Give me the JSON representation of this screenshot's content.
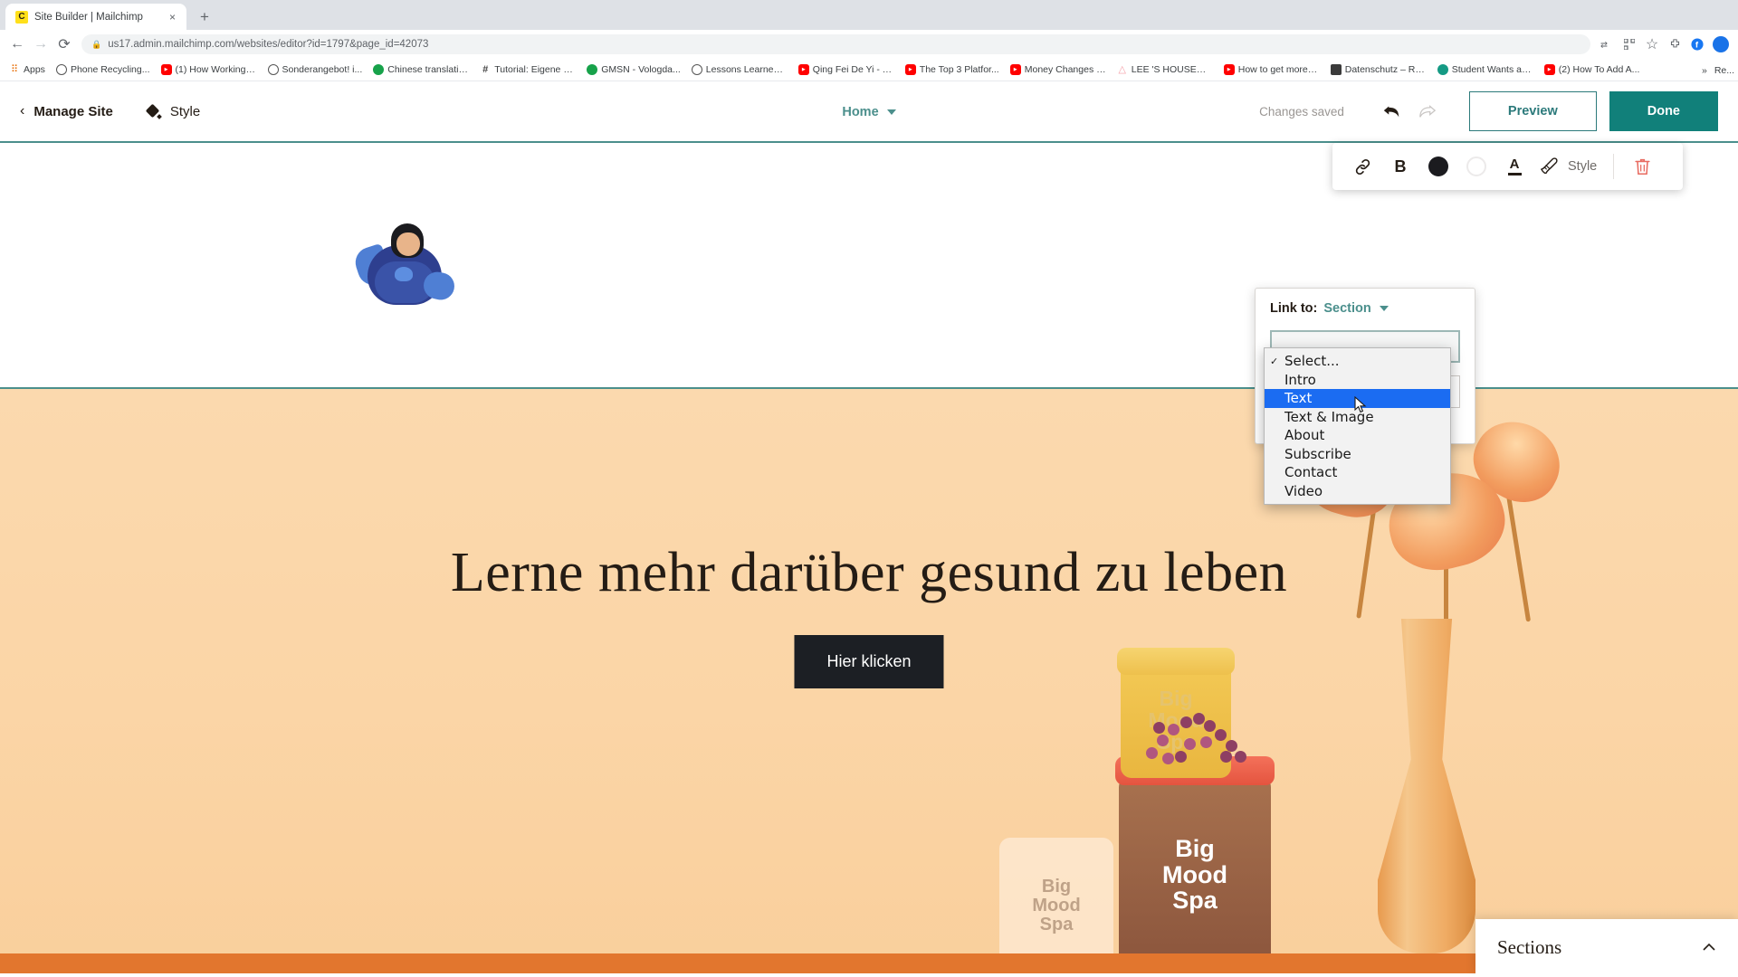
{
  "browser": {
    "tab": {
      "title": "Site Builder | Mailchimp",
      "favicon": "mailchimp-icon",
      "close_label": "×",
      "new_tab_label": "+"
    },
    "nav": {
      "back": "←",
      "forward": "→",
      "reload": "⟳",
      "lock": "🔒",
      "url": "us17.admin.mailchimp.com/websites/editor?id=1797&page_id=42073",
      "translate": "translate-icon",
      "qr": "qr-icon",
      "star": "☆",
      "extensions": "🧩",
      "facebook": "f",
      "profile": "profile-avatar"
    },
    "bookmarks": [
      {
        "label": "Apps",
        "icon": "apps-grid-icon",
        "icon_class": "ico-apps",
        "glyph": "⠿"
      },
      {
        "label": "Phone Recycling...",
        "icon": "o2-icon",
        "icon_class": "ico-circle",
        "glyph": ""
      },
      {
        "label": "(1) How Working a...",
        "icon": "youtube-icon",
        "icon_class": "ico-yt",
        "glyph": ""
      },
      {
        "label": "Sonderangebot! i...",
        "icon": "generic-icon",
        "icon_class": "ico-circle",
        "glyph": ""
      },
      {
        "label": "Chinese translatio...",
        "icon": "green-circle-icon",
        "icon_class": "ico-green",
        "glyph": ""
      },
      {
        "label": "Tutorial: Eigene Fa...",
        "icon": "hash-icon",
        "icon_class": "ico-hash",
        "glyph": "#"
      },
      {
        "label": "GMSN - Vologda...",
        "icon": "green-circle-icon",
        "icon_class": "ico-green",
        "glyph": ""
      },
      {
        "label": "Lessons Learned f...",
        "icon": "generic-icon",
        "icon_class": "ico-circle",
        "glyph": ""
      },
      {
        "label": "Qing Fei De Yi - Y...",
        "icon": "youtube-icon",
        "icon_class": "ico-yt",
        "glyph": ""
      },
      {
        "label": "The Top 3 Platfor...",
        "icon": "youtube-icon",
        "icon_class": "ico-yt",
        "glyph": ""
      },
      {
        "label": "Money Changes E...",
        "icon": "youtube-icon",
        "icon_class": "ico-yt",
        "glyph": ""
      },
      {
        "label": "LEE 'S HOUSE—...",
        "icon": "pink-triangle-icon",
        "icon_class": "ico-pink",
        "glyph": "△"
      },
      {
        "label": "How to get more v...",
        "icon": "youtube-icon",
        "icon_class": "ico-yt",
        "glyph": ""
      },
      {
        "label": "Datenschutz – Re...",
        "icon": "dark-icon",
        "icon_class": "ico-dark",
        "glyph": ""
      },
      {
        "label": "Student Wants an...",
        "icon": "teal-circle-icon",
        "icon_class": "ico-teal",
        "glyph": ""
      },
      {
        "label": "(2) How To Add A...",
        "icon": "youtube-icon",
        "icon_class": "ico-yt",
        "glyph": ""
      }
    ],
    "bookmarks_overflow": "»",
    "bookmarks_reading_list": "Re..."
  },
  "app_header": {
    "manage_site": "Manage Site",
    "back_chevron": "‹",
    "style": "Style",
    "style_icon": "paint-diamond-icon",
    "page_selector": "Home",
    "page_chevron": "chevron-down-icon",
    "changes_saved": "Changes saved",
    "undo_icon": "undo-arrow-icon",
    "redo_icon": "redo-arrow-icon",
    "preview_label": "Preview",
    "done_label": "Done"
  },
  "format_toolbar": {
    "link_icon": "link-icon",
    "bold_label": "B",
    "fill_color_swatch": "filled-circle-icon",
    "outline_color_swatch": "outline-circle-icon",
    "text_color_letter": "A",
    "brush_icon": "paintbrush-icon",
    "style_label": "Style",
    "delete_icon": "trash-icon"
  },
  "link_popover": {
    "link_to_label": "Link to:",
    "link_to_value": "Section",
    "chevron": "chevron-down-icon"
  },
  "section_dropdown": {
    "checkmark": "✓",
    "items": [
      {
        "label": "Select...",
        "checked": true,
        "highlighted": false
      },
      {
        "label": "Intro",
        "checked": false,
        "highlighted": false
      },
      {
        "label": "Text",
        "checked": false,
        "highlighted": true
      },
      {
        "label": "Text & Image",
        "checked": false,
        "highlighted": false
      },
      {
        "label": "About",
        "checked": false,
        "highlighted": false
      },
      {
        "label": "Subscribe",
        "checked": false,
        "highlighted": false
      },
      {
        "label": "Contact",
        "checked": false,
        "highlighted": false
      },
      {
        "label": "Video",
        "checked": false,
        "highlighted": false
      }
    ],
    "highlight_color": "#1b6cf2"
  },
  "canvas": {
    "logo_alt": "cartoon-superhero-logo",
    "hero_title": "Lerne mehr darüber gesund zu leben",
    "hero_cta": "Hier klicken",
    "product_jar_top": "Big\nMood\nSpa",
    "product_jar_top_lines": [
      "Big",
      "Mood",
      "Spa"
    ],
    "product_jar_main_lines": [
      "Big",
      "Mood",
      "Spa"
    ],
    "product_jar_left_lines": [
      "Big",
      "Mood",
      "Spa"
    ]
  },
  "sections_panel": {
    "title": "Sections",
    "collapse_icon": "chevron-up-icon"
  },
  "colors": {
    "brand_teal": "#11807a",
    "accent_teal": "#4b8f8c",
    "hero_bg": "#fbd5a6",
    "hero_strip": "#e2762e",
    "dropdown_highlight": "#1b6cf2",
    "cta_dark": "#1c1f24",
    "mailchimp_yellow": "#ffe01b"
  }
}
